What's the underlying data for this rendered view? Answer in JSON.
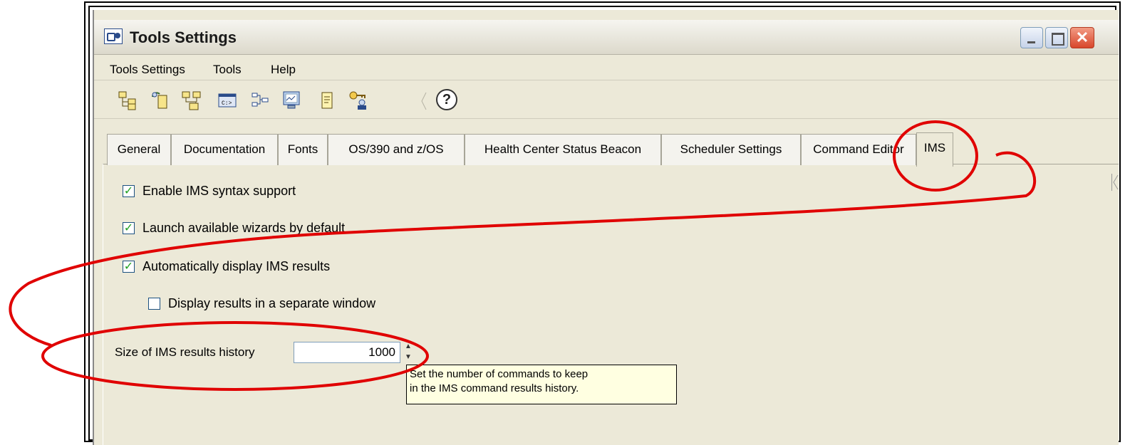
{
  "window": {
    "title": "Tools Settings"
  },
  "menubar": {
    "items": [
      "Tools Settings",
      "Tools",
      "Help"
    ]
  },
  "toolbar": {
    "icons": [
      "tree-icon",
      "configure-icon",
      "network-icon",
      "command-icon",
      "flow-icon",
      "monitor-icon",
      "notes-icon",
      "key-user-icon"
    ],
    "help_label": "?"
  },
  "tabs": [
    "General",
    "Documentation",
    "Fonts",
    "OS/390 and z/OS",
    "Health Center Status Beacon",
    "Scheduler Settings",
    "Command Editor",
    "IMS"
  ],
  "active_tab": "IMS",
  "ims": {
    "enable_syntax": {
      "label": "Enable IMS syntax support",
      "checked": true
    },
    "launch_wizards": {
      "label": "Launch available wizards by default",
      "checked": true
    },
    "auto_display": {
      "label": "Automatically display IMS results",
      "checked": true
    },
    "separate_window": {
      "label": "Display results in a separate window",
      "checked": false
    },
    "history_label": "Size of IMS results history",
    "history_value": "1000",
    "tooltip_line1": "Set the number of commands to keep",
    "tooltip_line2": "in the IMS command results history."
  },
  "colors": {
    "annotation": "#e00000",
    "window_bg": "#ece9d8",
    "tooltip_bg": "#ffffe1"
  }
}
